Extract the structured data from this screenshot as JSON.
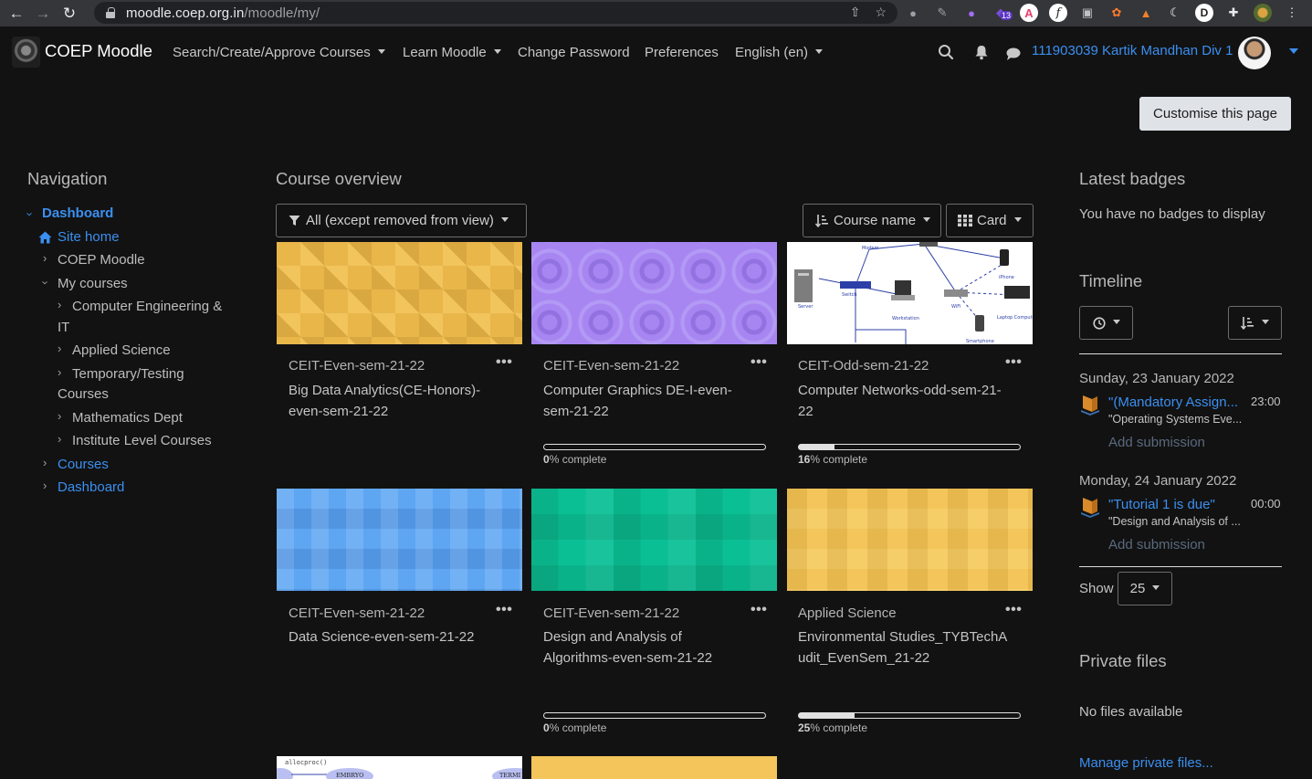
{
  "browser": {
    "url_host": "moodle.coep.org.in",
    "url_path": "/moodle/my/",
    "extension_badge": "13"
  },
  "header": {
    "brand": "COEP Moodle",
    "menu": [
      {
        "label": "Search/Create/Approve Courses"
      },
      {
        "label": "Learn Moodle"
      },
      {
        "label": "Change Password"
      },
      {
        "label": "Preferences"
      },
      {
        "label": "English (en)"
      }
    ],
    "user_name": "111903039 Kartik Mandhan Div 1",
    "customise_label": "Customise this page"
  },
  "navigation": {
    "title": "Navigation",
    "dashboard": "Dashboard",
    "site_home": "Site home",
    "coep_moodle": "COEP Moodle",
    "my_courses": "My courses",
    "cat_1_line1": "Computer Engineering &",
    "cat_1_line2": "IT",
    "cat_2": "Applied Science",
    "cat_3_line1": "Temporary/Testing",
    "cat_3_line2": "Courses",
    "cat_4": "Mathematics Dept",
    "cat_5": "Institute Level Courses",
    "courses": "Courses",
    "dashboard_2": "Dashboard"
  },
  "overview": {
    "title": "Course overview",
    "filter_label": "All (except removed from view)",
    "sort_label": "Course name",
    "view_label": "Card",
    "complete_suffix": "% complete",
    "cards": [
      {
        "category": "CEIT-Even-sem-21-22",
        "name": "Big Data Analytics(CE-Honors)-even-sem-21-22",
        "progress": null,
        "pattern": "gold-diamonds"
      },
      {
        "category": "CEIT-Even-sem-21-22",
        "name": "Computer Graphics DE-I-even-sem-21-22",
        "progress": 0,
        "pattern": "purple-circles"
      },
      {
        "category": "CEIT-Odd-sem-21-22",
        "name": "Computer Networks-odd-sem-21-22",
        "progress": 16,
        "pattern": "network-diagram"
      },
      {
        "category": "CEIT-Even-sem-21-22",
        "name": "Data Science-even-sem-21-22",
        "progress": null,
        "pattern": "blue-squares"
      },
      {
        "category": "CEIT-Even-sem-21-22",
        "name": "Design and Analysis of Algorithms-even-sem-21-22",
        "progress": 0,
        "pattern": "green-blocks"
      },
      {
        "category": "Applied Science",
        "name": "Environmental Studies_TYBTechAudit_EvenSem_21-22",
        "progress": 25,
        "pattern": "yellow-squares"
      }
    ],
    "partial_card_text": [
      "allocproc()",
      "EMBRYO",
      "TERMI"
    ]
  },
  "badges": {
    "title": "Latest badges",
    "empty_text": "You have no badges to display"
  },
  "timeline": {
    "title": "Timeline",
    "events": [
      {
        "date": "Sunday, 23 January 2022",
        "title": "\"(Mandatory Assign...",
        "subtitle": "\"Operating Systems Eve...",
        "time": "23:00",
        "action": "Add submission"
      },
      {
        "date": "Monday, 24 January 2022",
        "title": "\"Tutorial 1 is due\"",
        "subtitle": "\"Design and Analysis of ...",
        "time": "00:00",
        "action": "Add submission"
      }
    ],
    "show_label": "Show",
    "show_value": "25"
  },
  "private_files": {
    "title": "Private files",
    "empty_text": "No files available",
    "manage_link": "Manage private files..."
  },
  "colors": {
    "accent_link": "#3b8ff0",
    "background": "#121212"
  }
}
